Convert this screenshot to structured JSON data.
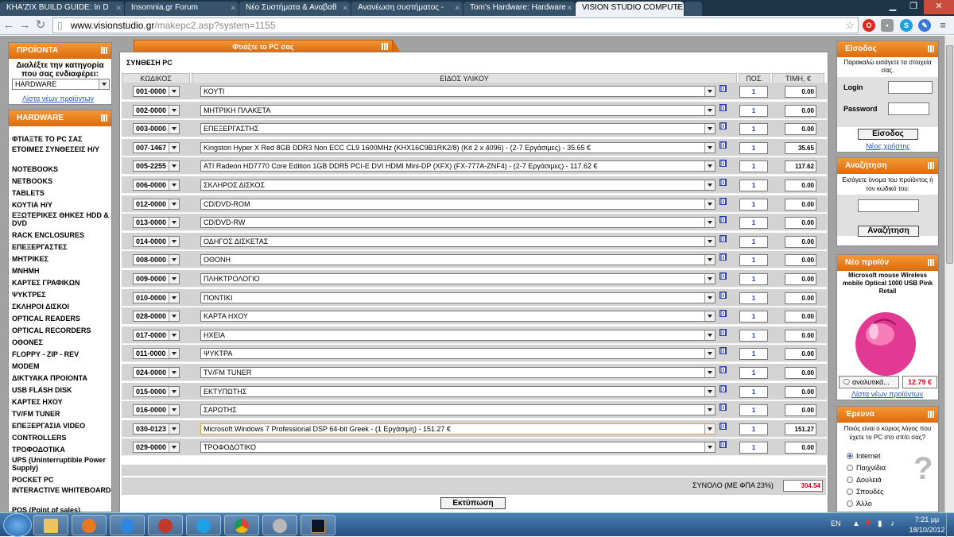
{
  "browser": {
    "tabs": [
      {
        "label": "KHA'ZIX BUILD GUIDE: In D",
        "active": false
      },
      {
        "label": "Insomnia.gr Forum",
        "active": false
      },
      {
        "label": "Νέο Συστήματα & Αναβαθ",
        "active": false
      },
      {
        "label": "Ανανέωση συστήματος -",
        "active": false
      },
      {
        "label": "Tom's Hardware: Hardware",
        "active": false
      },
      {
        "label": "VISION STUDIO COMPUTE",
        "active": true
      }
    ],
    "url_domain": "www.visionstudio.gr",
    "url_path": "/makepc2.asp?system=1155"
  },
  "sidebar": {
    "products_title": "ΠΡΟΪΟΝΤΑ",
    "products_prompt": "Διαλέξτε την κατηγορία που σας ενδιαφέρει:",
    "category_select": "HARDWARE",
    "new_products_link": "Λίστα νέων προϊόντων",
    "hardware_title": "HARDWARE",
    "categories": [
      "ΦΤΙΑΞΤΕ ΤΟ PC ΣΑΣ",
      "ΕΤΟΙΜΕΣ ΣΥΝΘΕΣΕΙΣ Η/Υ",
      "NOTEBOOKS",
      "NETBOOKS",
      "TABLETS",
      "ΚΟΥΤΙΑ Η/Υ",
      "ΕΞΩΤΕΡΙΚΕΣ ΘΗΚΕΣ HDD & DVD",
      "RACK ENCLOSURES",
      "ΕΠΕΞΕΡΓΑΣΤΕΣ",
      "ΜΗΤΡΙΚΕΣ",
      "ΜΝΗΜΗ",
      "ΚΑΡΤΕΣ ΓΡΑΦΙΚΩΝ",
      "ΨΥΚΤΡΕΣ",
      "ΣΚΛΗΡΟΙ ΔΙΣΚΟΙ",
      "OPTICAL READERS",
      "OPTICAL RECORDERS",
      "ΟΘΟΝΕΣ",
      "FLOPPY - ZIP - REV",
      "MODEM",
      "ΔΙΚΤΥΑΚΑ ΠΡΟΙΟΝΤΑ",
      "USB FLASH DISK",
      "ΚΑΡΤΕΣ ΗΧΟΥ",
      "TV/FM TUNER",
      "ΕΠΕΞΕΡΓΑΣΙΑ VIDEO",
      "CONTROLLERS",
      "ΤΡΟΦΟΔΟΤΙΚΑ",
      "UPS (Uninterruptible Power Supply)",
      "POCKET PC",
      "INTERACTIVE WHITEBOARD",
      "POS (Point of sales)"
    ]
  },
  "builder": {
    "tab_title": "Φτιάξτε το PC σας",
    "section_title": "ΣΥΝΘΕΣΗ PC",
    "col_code": "ΚΩΔΙΚΟΣ",
    "col_item": "ΕΙΔΟΣ ΥΛΙΚΟΥ",
    "col_qty": "ΠΟΣ.",
    "col_price": "ΤΙΜΗ, €",
    "rows": [
      {
        "code": "001-0000",
        "item": "ΚΟΥΤΙ",
        "qty": "1",
        "price": "0.00"
      },
      {
        "code": "002-0000",
        "item": "ΜΗΤΡΙΚΗ ΠΛΑΚΕΤΑ",
        "qty": "1",
        "price": "0.00"
      },
      {
        "code": "003-0000",
        "item": "ΕΠΕΞΕΡΓΑΣΤΗΣ",
        "qty": "1",
        "price": "0.00"
      },
      {
        "code": "007-1467",
        "item": "Kingston Hyper X Red 8GB DDR3 Non ECC CL9 1600MHz (KHX16C9B1RK2/8) (Kit 2 x 4096) - (2-7 Εργάσιμες) - 35.65 €",
        "qty": "1",
        "price": "35.65"
      },
      {
        "code": "005-2255",
        "item": "ATI Radeon HD7770 Core Edition 1GB DDR5 PCI-E DVI HDMI Mini-DP (XFX) (FX-777A-ZNF4) - (2-7 Εργάσιμες) - 117.62 €",
        "qty": "1",
        "price": "117.62"
      },
      {
        "code": "006-0000",
        "item": "ΣΚΛΗΡΟΣ ΔΙΣΚΟΣ",
        "qty": "1",
        "price": "0.00"
      },
      {
        "code": "012-0000",
        "item": "CD/DVD-ROM",
        "qty": "1",
        "price": "0.00"
      },
      {
        "code": "013-0000",
        "item": "CD/DVD-RW",
        "qty": "1",
        "price": "0.00"
      },
      {
        "code": "014-0000",
        "item": "ΟΔΗΓΟΣ ΔΙΣΚΕΤΑΣ",
        "qty": "1",
        "price": "0.00"
      },
      {
        "code": "008-0000",
        "item": "ΟΘΟΝΗ",
        "qty": "1",
        "price": "0.00"
      },
      {
        "code": "009-0000",
        "item": "ΠΛΗΚΤΡΟΛΟΓΙΟ",
        "qty": "1",
        "price": "0.00"
      },
      {
        "code": "010-0000",
        "item": "ΠΟΝΤΙΚΙ",
        "qty": "1",
        "price": "0.00"
      },
      {
        "code": "028-0000",
        "item": "ΚΑΡΤΑ ΗΧΟΥ",
        "qty": "1",
        "price": "0.00"
      },
      {
        "code": "017-0000",
        "item": "ΗΧΕΙΑ",
        "qty": "1",
        "price": "0.00"
      },
      {
        "code": "011-0000",
        "item": "ΨΥΚΤΡΑ",
        "qty": "1",
        "price": "0.00"
      },
      {
        "code": "024-0000",
        "item": "TV/FM TUNER",
        "qty": "1",
        "price": "0.00"
      },
      {
        "code": "015-0000",
        "item": "ΕΚΤΥΠΩΤΗΣ",
        "qty": "1",
        "price": "0.00"
      },
      {
        "code": "016-0000",
        "item": "ΣΑΡΩΤΗΣ",
        "qty": "1",
        "price": "0.00"
      },
      {
        "code": "030-0123",
        "item": "Microsoft Windows 7 Professional DSP 64-bit Greek - (1 Εργάσιμη) - 151.27 €",
        "qty": "1",
        "price": "151.27"
      },
      {
        "code": "029-0000",
        "item": "ΤΡΟΦΟΔΟΤΙΚΟ",
        "qty": "1",
        "price": "0.00"
      }
    ],
    "info_icon": "[i]",
    "total_label": "ΣΥΝΟΛΟ (ΜΕ ΦΠΑ 23%)",
    "total_value": "304.54",
    "print_button": "Εκτύπωση"
  },
  "login": {
    "title": "Είσοδος",
    "prompt": "Παρακαλώ εισάγετε τα στοιχεία σας.",
    "login_label": "Login",
    "password_label": "Password",
    "button": "Είσοδος",
    "new_user_link": "Νέος χρήστης"
  },
  "search": {
    "title": "Αναζήτηση",
    "prompt": "Εισάγετε όνομα του προϊόντος ή τον κωδικό του:",
    "button": "Αναζήτηση"
  },
  "new_product": {
    "title": "Νέο προϊόν",
    "name": "Microsoft mouse Wireless mobile Optical 1000 USB Pink Retail",
    "details_link": "αναλυτικά...",
    "price": "12.79 €",
    "list_link": "Λίστα νέων προϊόντων"
  },
  "poll": {
    "title": "Έρευνα",
    "question": "Ποιός είναι ο κύριος λόγος που έχετε το PC στο σπίτι σας?",
    "options": [
      "Internet",
      "Παιχνίδια",
      "Δουλειά",
      "Σπουδές",
      "Άλλο"
    ],
    "selected_index": 0,
    "question_mark": "?"
  },
  "taskbar": {
    "language": "EN",
    "time": "7:21 μμ",
    "date": "18/10/2012"
  },
  "colors": {
    "orange_header": "#f08a24",
    "link_blue": "#2455c3",
    "total_red": "#e8001c"
  }
}
